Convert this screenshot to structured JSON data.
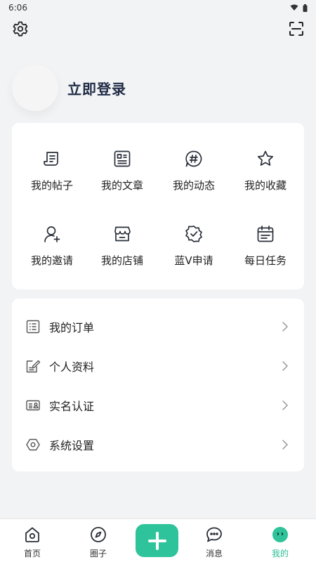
{
  "status_bar": {
    "time": "6:06"
  },
  "profile": {
    "login_label": "立即登录"
  },
  "grid": [
    {
      "label": "我的帖子",
      "icon": "scroll-icon"
    },
    {
      "label": "我的文章",
      "icon": "article-icon"
    },
    {
      "label": "我的动态",
      "icon": "hashtag-chat-icon"
    },
    {
      "label": "我的收藏",
      "icon": "star-icon"
    },
    {
      "label": "我的邀请",
      "icon": "user-add-icon"
    },
    {
      "label": "我的店铺",
      "icon": "shop-icon"
    },
    {
      "label": "蓝V申请",
      "icon": "verified-badge-icon"
    },
    {
      "label": "每日任务",
      "icon": "calendar-task-icon"
    }
  ],
  "list": [
    {
      "label": "我的订单",
      "icon": "order-list-icon"
    },
    {
      "label": "个人资料",
      "icon": "edit-profile-icon"
    },
    {
      "label": "实名认证",
      "icon": "id-card-icon"
    },
    {
      "label": "系统设置",
      "icon": "hexagon-settings-icon"
    }
  ],
  "nav": [
    {
      "label": "首页",
      "icon": "home-icon",
      "active": false
    },
    {
      "label": "圈子",
      "icon": "compass-icon",
      "active": false
    },
    {
      "label": "消息",
      "icon": "message-icon",
      "active": false
    },
    {
      "label": "我的",
      "icon": "profile-face-icon",
      "active": true
    }
  ],
  "colors": {
    "accent": "#2ec39a",
    "active_text": "#2bbf93",
    "background": "#f2f3f5"
  }
}
